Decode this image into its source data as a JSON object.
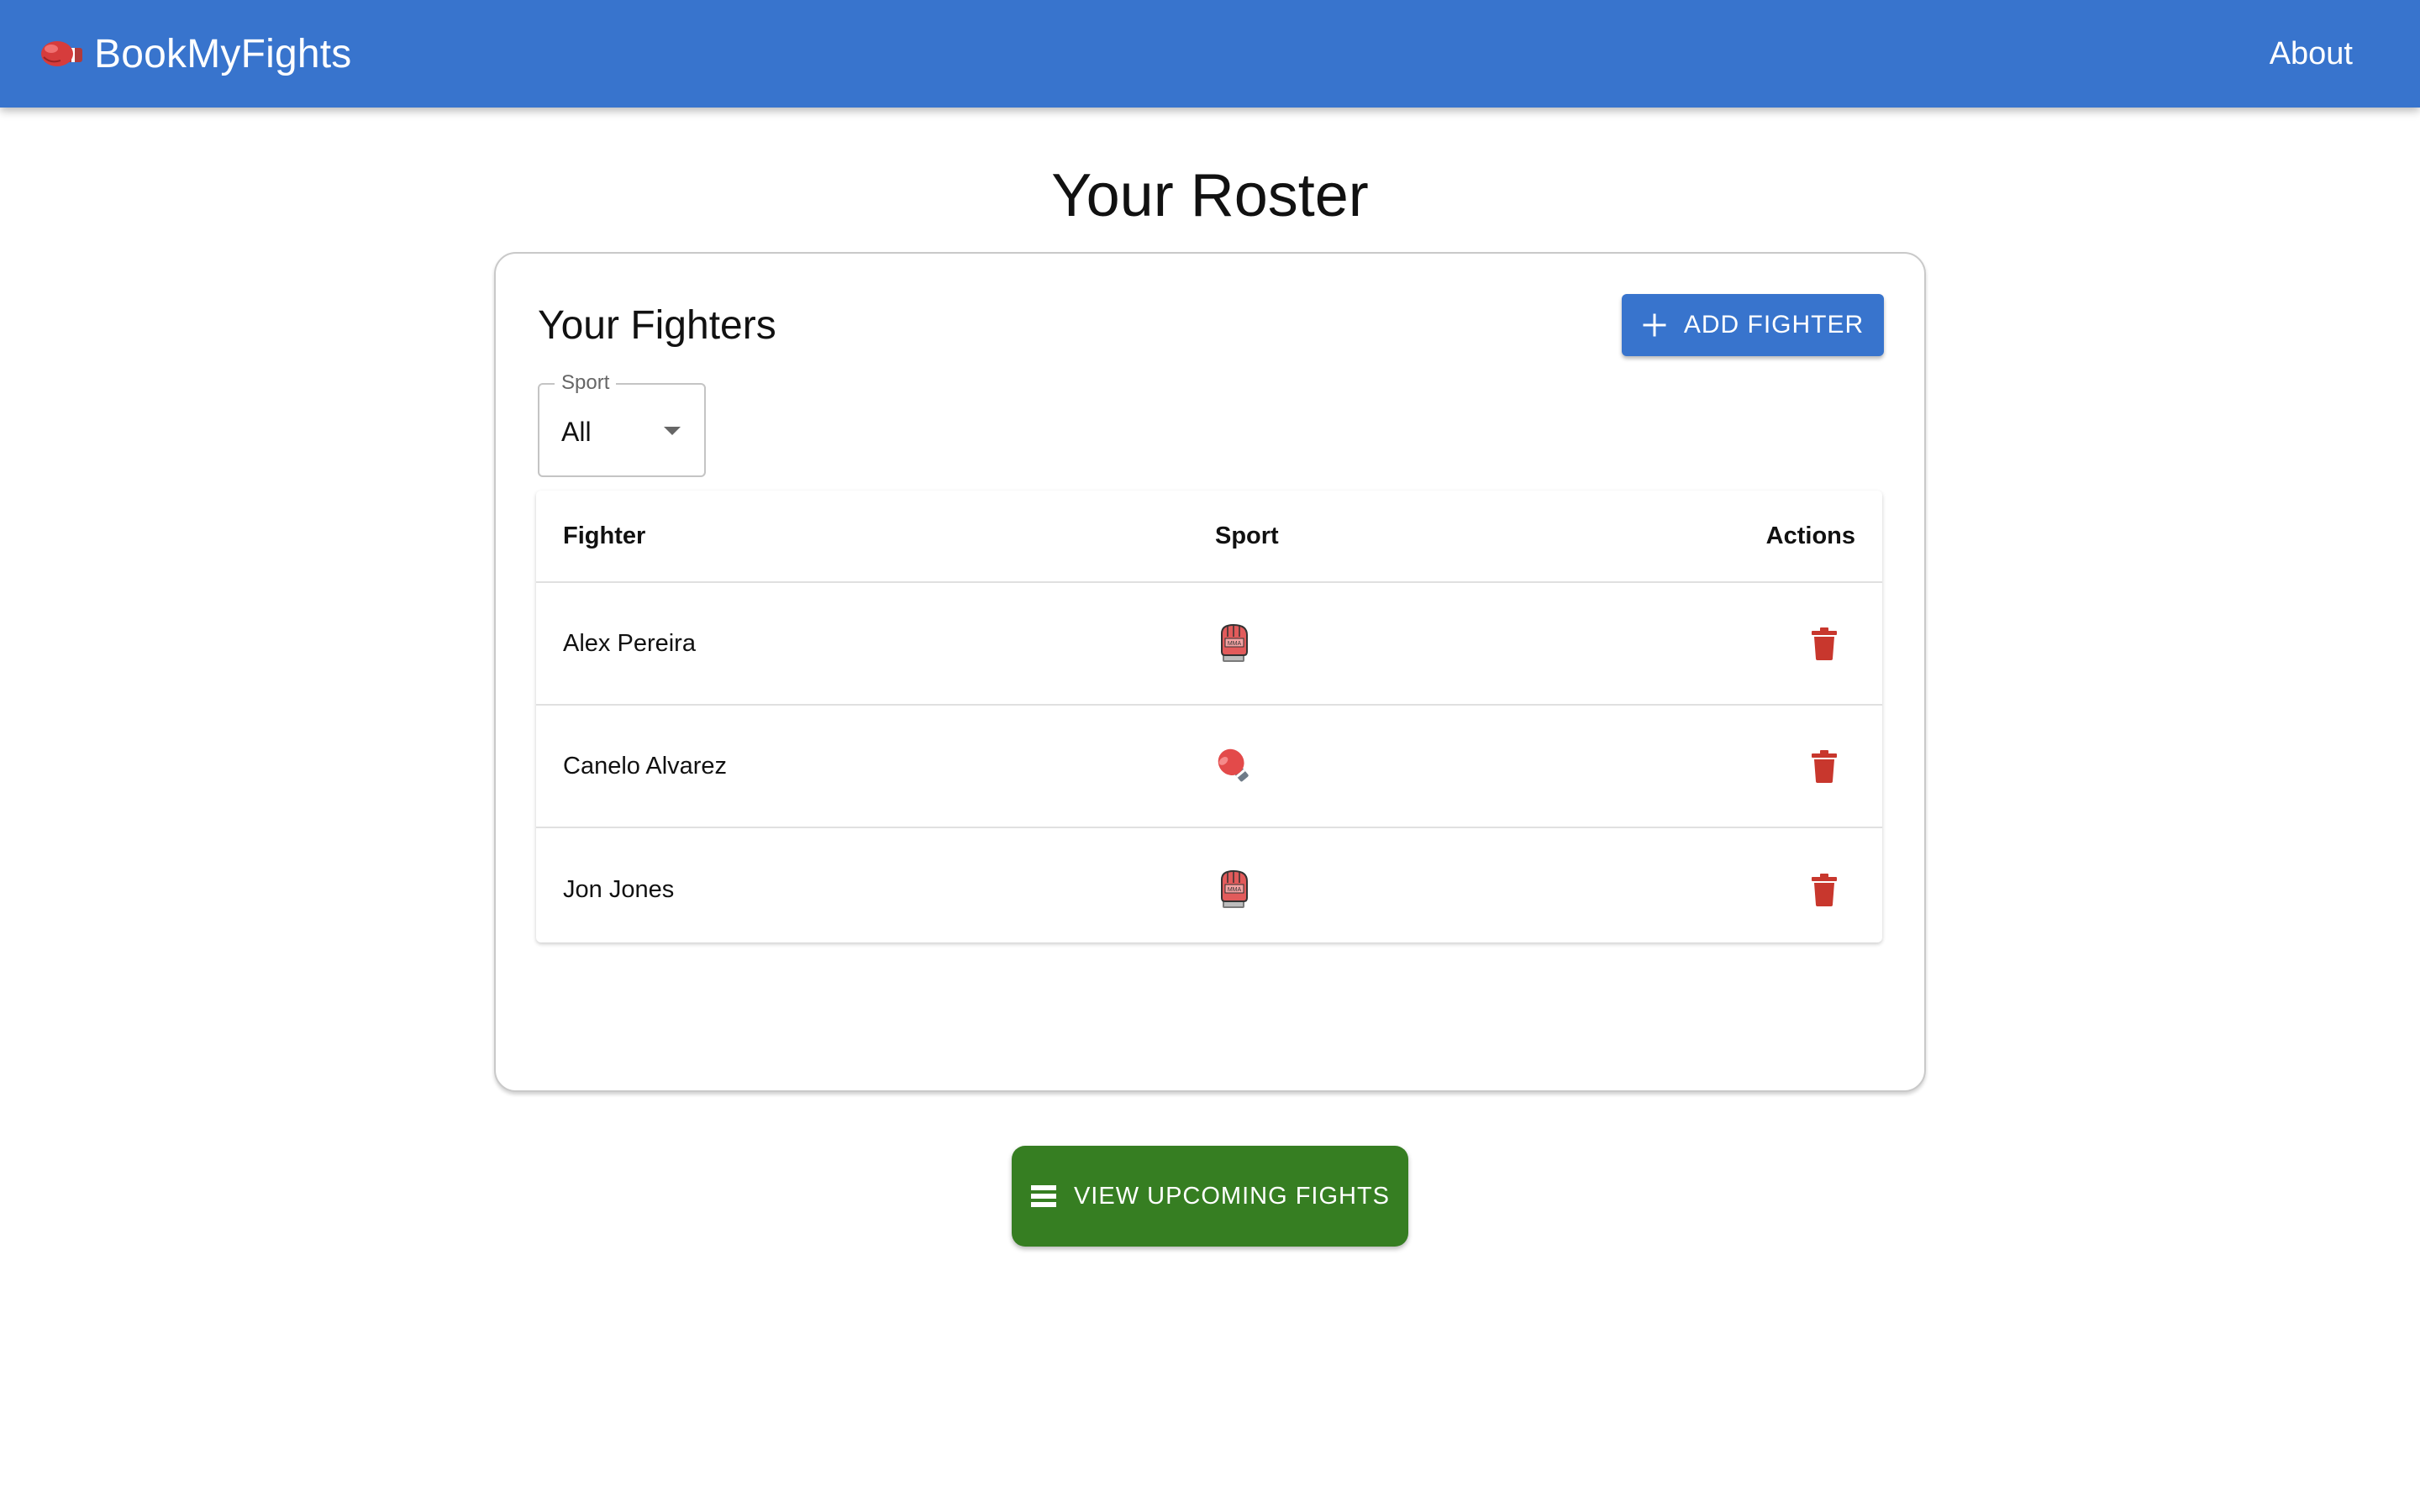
{
  "appbar": {
    "brand_icon": "boxing-glove-icon",
    "brand_name": "BookMyFights",
    "nav_about": "About",
    "color": "#3874cd"
  },
  "page": {
    "title": "Your Roster"
  },
  "roster_card": {
    "title": "Your Fighters",
    "add_button": {
      "label": "Add Fighter",
      "icon": "plus-icon"
    },
    "sport_filter": {
      "label": "Sport",
      "value": "All"
    },
    "table": {
      "headers": {
        "fighter": "Fighter",
        "sport": "Sport",
        "actions": "Actions"
      },
      "rows": [
        {
          "fighter": "Alex Pereira",
          "sport_icon": "mma-glove-icon",
          "action_icon": "trash-icon"
        },
        {
          "fighter": "Canelo Alvarez",
          "sport_icon": "boxing-glove-icon",
          "action_icon": "trash-icon"
        },
        {
          "fighter": "Jon Jones",
          "sport_icon": "mma-glove-icon",
          "action_icon": "trash-icon"
        }
      ]
    }
  },
  "upcoming_button": {
    "label": "View Upcoming Fights",
    "icon": "list-icon",
    "color": "#367e22"
  },
  "colors": {
    "danger": "#c8372d"
  }
}
